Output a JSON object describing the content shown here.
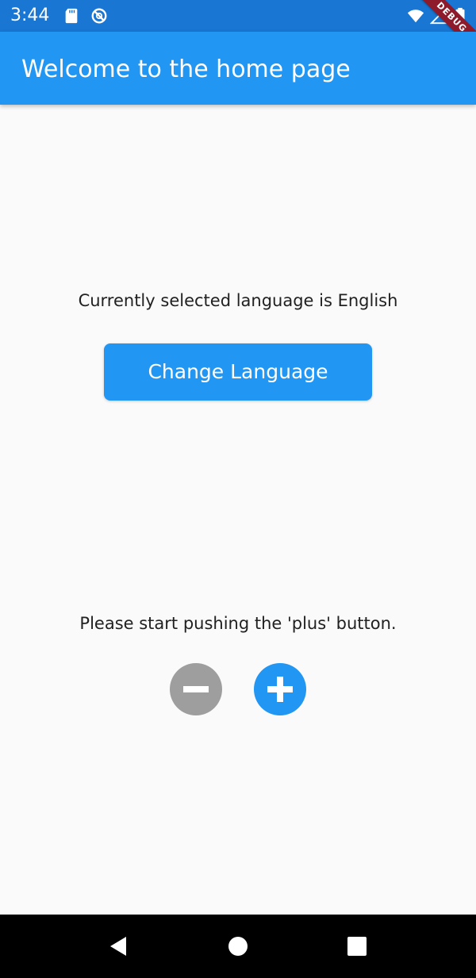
{
  "status_bar": {
    "time": "3:44",
    "debug_label": "DEBUG",
    "background_color": "#1976d2",
    "icons": [
      "sd-card-icon",
      "no-sync-icon",
      "wifi-icon",
      "signal-icon",
      "battery-icon"
    ]
  },
  "app_bar": {
    "title": "Welcome to the home page",
    "color": "#2196f3"
  },
  "language_section": {
    "label": "Currently selected language is English",
    "button_label": "Change Language"
  },
  "counter_section": {
    "label": "Please start pushing the 'plus' button.",
    "minus_color": "#9e9e9e",
    "plus_color": "#2196f3",
    "minus_icon": "minus-icon",
    "plus_icon": "plus-icon"
  },
  "nav_bar": {
    "icons": [
      "back-icon",
      "home-icon",
      "recents-icon"
    ]
  }
}
